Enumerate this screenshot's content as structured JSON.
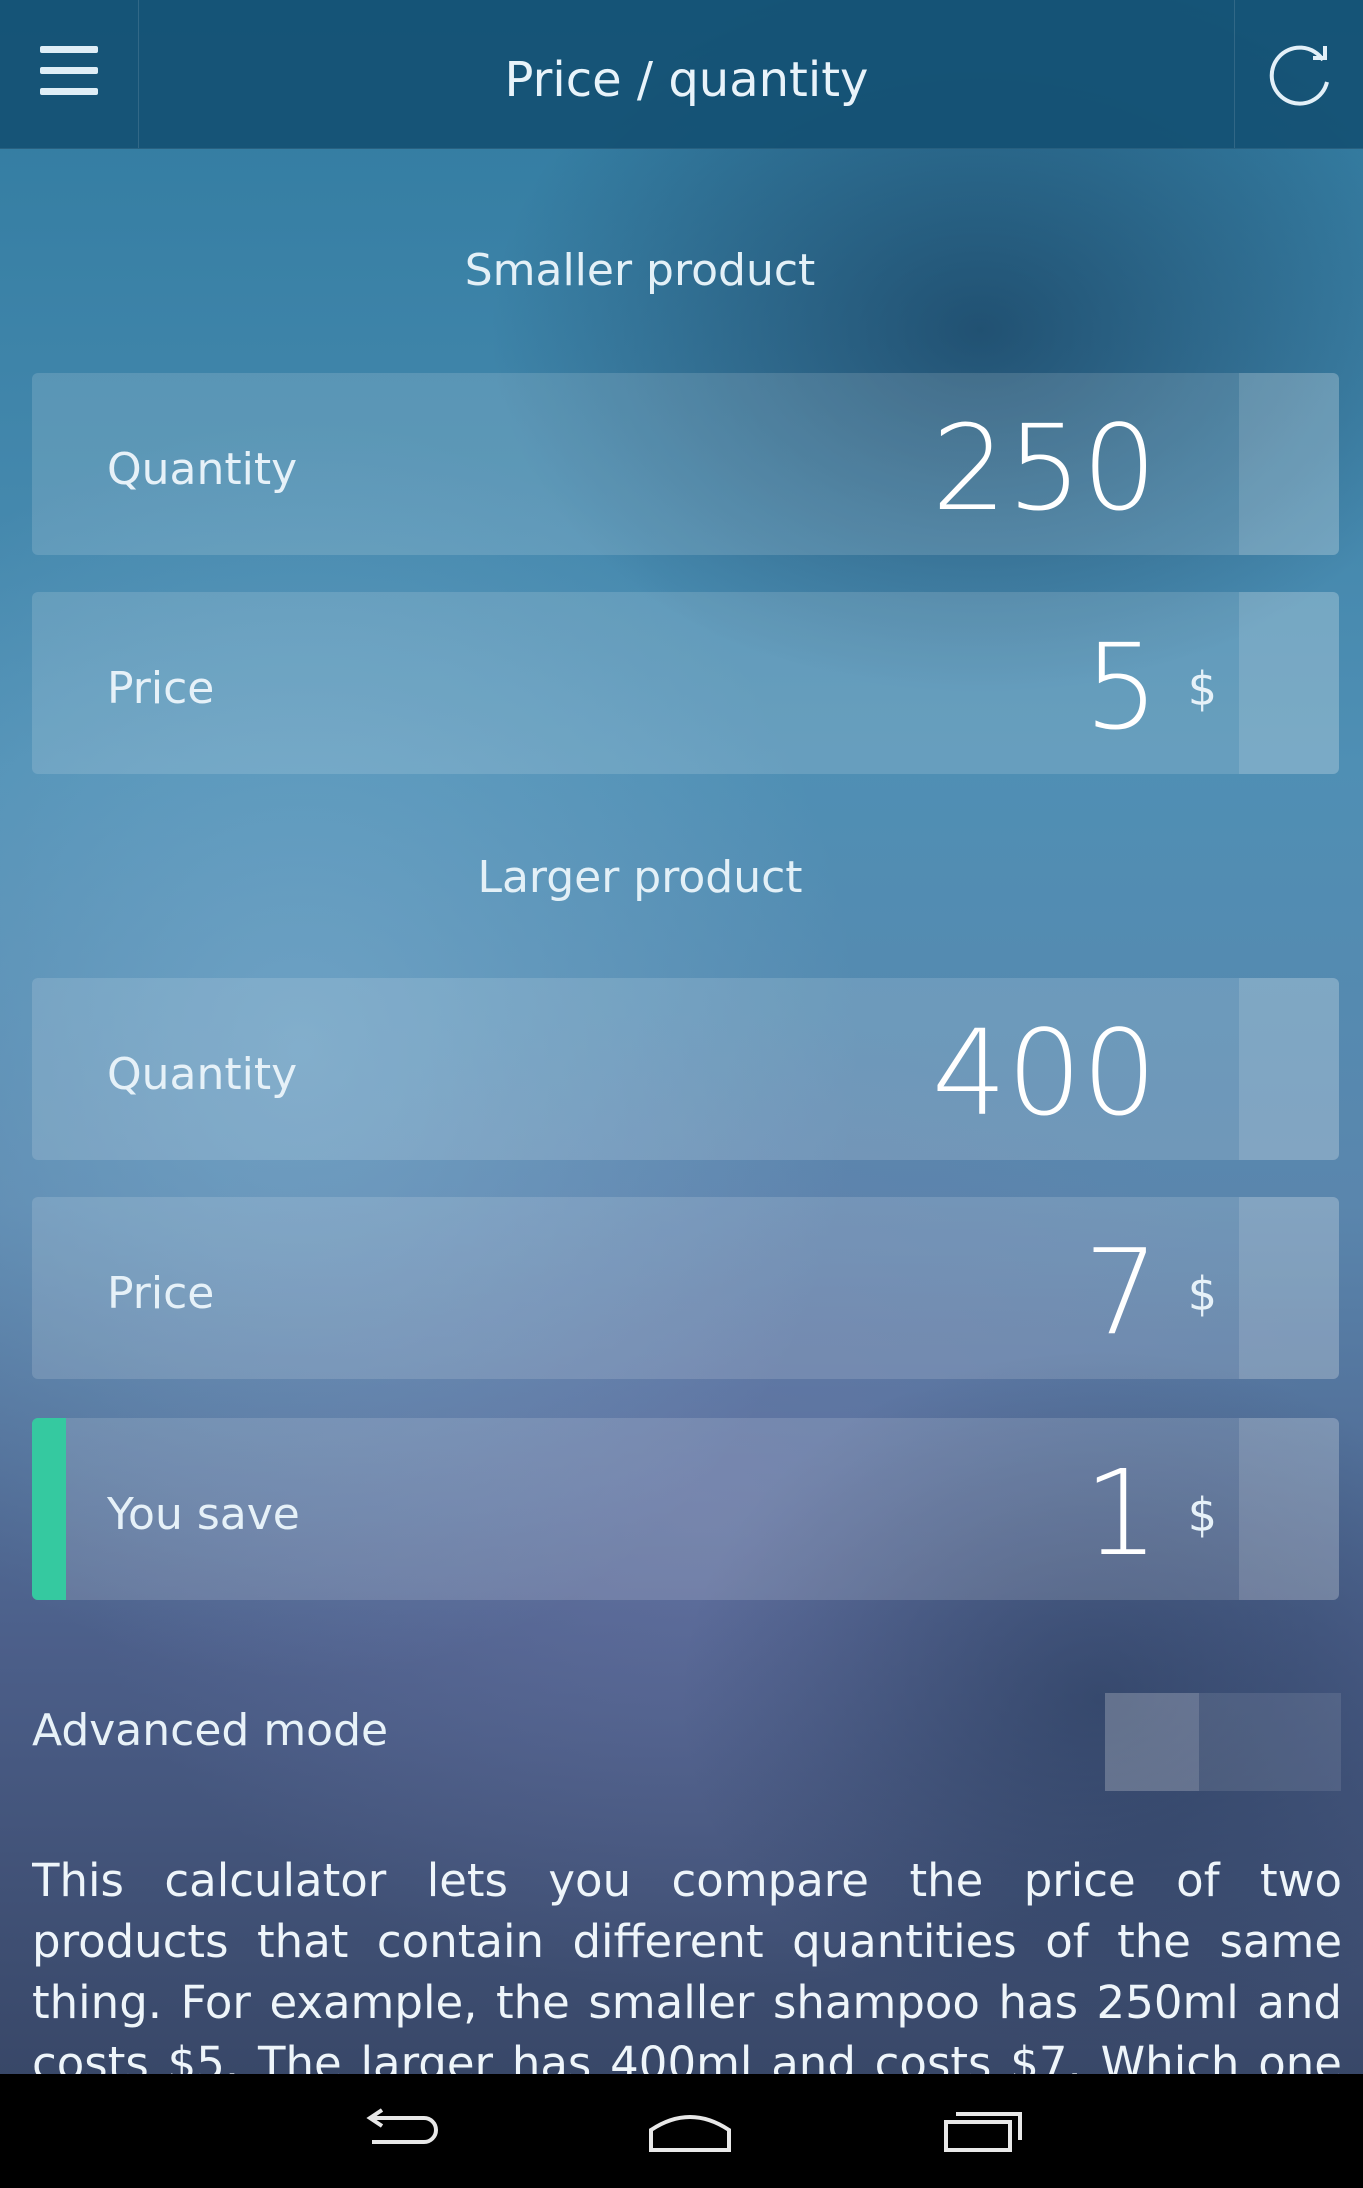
{
  "header": {
    "title": "Price / quantity"
  },
  "smaller": {
    "heading": "Smaller product",
    "quantity_label": "Quantity",
    "quantity_value": "250",
    "price_label": "Price",
    "price_value": "5",
    "price_unit": "$"
  },
  "larger": {
    "heading": "Larger product",
    "quantity_label": "Quantity",
    "quantity_value": "400",
    "price_label": "Price",
    "price_value": "7",
    "price_unit": "$"
  },
  "savings": {
    "label": "You save",
    "value": "1",
    "unit": "$"
  },
  "advanced": {
    "label": "Advanced mode",
    "enabled": false
  },
  "description": "This calculator lets you compare the price of two products that contain different quantities of the same thing. For example, the smaller shampoo has 250ml and costs $5. The larger has 400ml and costs $7. Which one should you get?",
  "icons": {
    "menu": "hamburger-icon",
    "refresh": "refresh-icon",
    "back": "back-icon",
    "home": "home-icon",
    "recents": "recents-icon"
  },
  "colors": {
    "accent": "#35c9a0",
    "topbar": "#145073"
  }
}
